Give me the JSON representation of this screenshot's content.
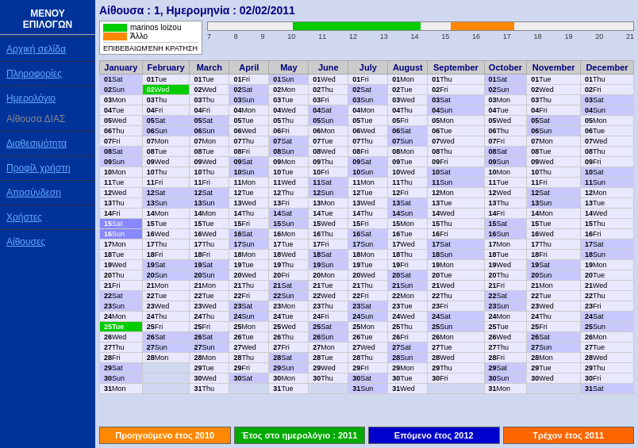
{
  "sidebar": {
    "title": "ΜΕΝΟΥ ΕΠΙΛΟΓΩΝ",
    "items": [
      {
        "label": "Αρχική σελίδα",
        "active": true,
        "disabled": false
      },
      {
        "label": "Πληροφορίες",
        "active": false,
        "disabled": false
      },
      {
        "label": "Ημερολόγιο",
        "active": false,
        "disabled": false
      },
      {
        "label": "Αίθουσα ΔΙΑΣ",
        "active": false,
        "disabled": true
      },
      {
        "label": "Διαθεσιμότητα",
        "active": false,
        "disabled": false
      },
      {
        "label": "Προφίλ χρήστη",
        "active": false,
        "disabled": false
      },
      {
        "label": "Αποσύνδεση",
        "active": false,
        "disabled": false
      },
      {
        "label": "Χρήστες",
        "active": false,
        "disabled": false
      },
      {
        "label": "Αίθουσες",
        "active": false,
        "disabled": false
      }
    ]
  },
  "header": {
    "title": "Αίθουσα : 1, Ημερομηνία : 02/02/2011"
  },
  "legend": {
    "user_name": "marinos loizou",
    "other_label": "Άλλο",
    "confirmed_label": "ΕΠΙΒΕΒΑΙΩΜΈΝΗ ΚΡΑΤΗΣΗ",
    "scale_ticks": [
      "7",
      "8",
      "9",
      "10",
      "11",
      "12",
      "13",
      "14",
      "15",
      "16",
      "17",
      "18",
      "19",
      "20",
      "21"
    ],
    "green_start_pct": 20,
    "green_width_pct": 30,
    "orange_start_pct": 57,
    "orange_width_pct": 15
  },
  "footer": {
    "prev_label": "Προηγούμενο έτος 2010",
    "curr_label": "Έτος στο ημερολόγιο : 2011",
    "next_label": "Επόμενο έτος 2012",
    "today_label": "Τρέχον έτος 2011"
  },
  "months": [
    "January",
    "February",
    "March",
    "April",
    "May",
    "June",
    "July",
    "August",
    "September",
    "October",
    "November",
    "December"
  ],
  "calendar_data": {
    "january": [
      {
        "n": "01",
        "d": "Sat",
        "cls": "cell-weekend"
      },
      {
        "n": "02",
        "d": "Sun",
        "cls": "cell-weekend"
      },
      {
        "n": "03",
        "d": "Mon",
        "cls": "cell-normal"
      },
      {
        "n": "04",
        "d": "Tue",
        "cls": "cell-normal"
      },
      {
        "n": "05",
        "d": "Wed",
        "cls": "cell-normal"
      },
      {
        "n": "06",
        "d": "Thu",
        "cls": "cell-normal"
      },
      {
        "n": "07",
        "d": "Fri",
        "cls": "cell-normal"
      },
      {
        "n": "08",
        "d": "Sat",
        "cls": "cell-weekend"
      },
      {
        "n": "09",
        "d": "Sun",
        "cls": "cell-weekend"
      },
      {
        "n": "10",
        "d": "Mon",
        "cls": "cell-normal"
      },
      {
        "n": "11",
        "d": "Tue",
        "cls": "cell-normal"
      },
      {
        "n": "12",
        "d": "Wed",
        "cls": "cell-normal"
      },
      {
        "n": "13",
        "d": "Thu",
        "cls": "cell-normal"
      },
      {
        "n": "14",
        "d": "Fri",
        "cls": "cell-normal"
      },
      {
        "n": "15",
        "d": "Sat",
        "cls": "cell-blue"
      },
      {
        "n": "16",
        "d": "Sun",
        "cls": "cell-blue"
      },
      {
        "n": "17",
        "d": "Mon",
        "cls": "cell-normal"
      },
      {
        "n": "18",
        "d": "Tue",
        "cls": "cell-normal"
      },
      {
        "n": "19",
        "d": "Wed",
        "cls": "cell-normal"
      },
      {
        "n": "20",
        "d": "Thu",
        "cls": "cell-normal"
      },
      {
        "n": "21",
        "d": "Fri",
        "cls": "cell-normal"
      },
      {
        "n": "22",
        "d": "Sat",
        "cls": "cell-weekend"
      },
      {
        "n": "23",
        "d": "Sun",
        "cls": "cell-weekend"
      },
      {
        "n": "24",
        "d": "Mon",
        "cls": "cell-normal"
      },
      {
        "n": "25",
        "d": "Tue",
        "cls": "cell-today"
      },
      {
        "n": "26",
        "d": "Wed",
        "cls": "cell-normal"
      },
      {
        "n": "27",
        "d": "Thu",
        "cls": "cell-normal"
      },
      {
        "n": "28",
        "d": "Fri",
        "cls": "cell-normal"
      },
      {
        "n": "29",
        "d": "Sat",
        "cls": "cell-weekend"
      },
      {
        "n": "30",
        "d": "Sun",
        "cls": "cell-weekend"
      },
      {
        "n": "31",
        "d": "Mon",
        "cls": "cell-normal"
      }
    ]
  }
}
